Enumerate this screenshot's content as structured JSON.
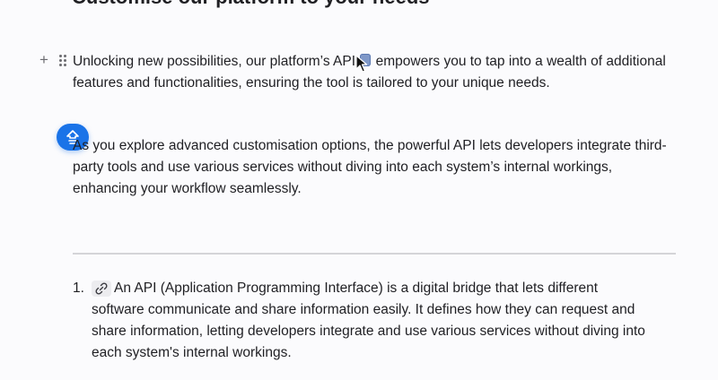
{
  "heading": "Customise our platform to your needs",
  "toolbar": {
    "add_icon": "plus-icon",
    "drag_icon": "drag-handle-icon"
  },
  "para1": {
    "before": "Unlocking new possibilities, our platform’s API ",
    "after": " empowers you to tap into a wealth of additional features and functionalities, ensuring the tool is tailored to your unique needs."
  },
  "para2": "As you explore advanced customisation options, the powerful API lets developers integrate third-party tools and use various services without diving into each system’s internal workings, enhancing your workflow seamlessly.",
  "fab": {
    "icon": "ai-assist-icon",
    "color": "#1a73e8"
  },
  "list": {
    "items": [
      {
        "number": "1.",
        "icon": "link-icon",
        "text": "An API (Application Programming Interface) is a digital bridge that lets different software communicate and share information easily. It defines how they can request and share information, letting developers integrate and use various services without diving into each system's internal workings."
      }
    ]
  }
}
